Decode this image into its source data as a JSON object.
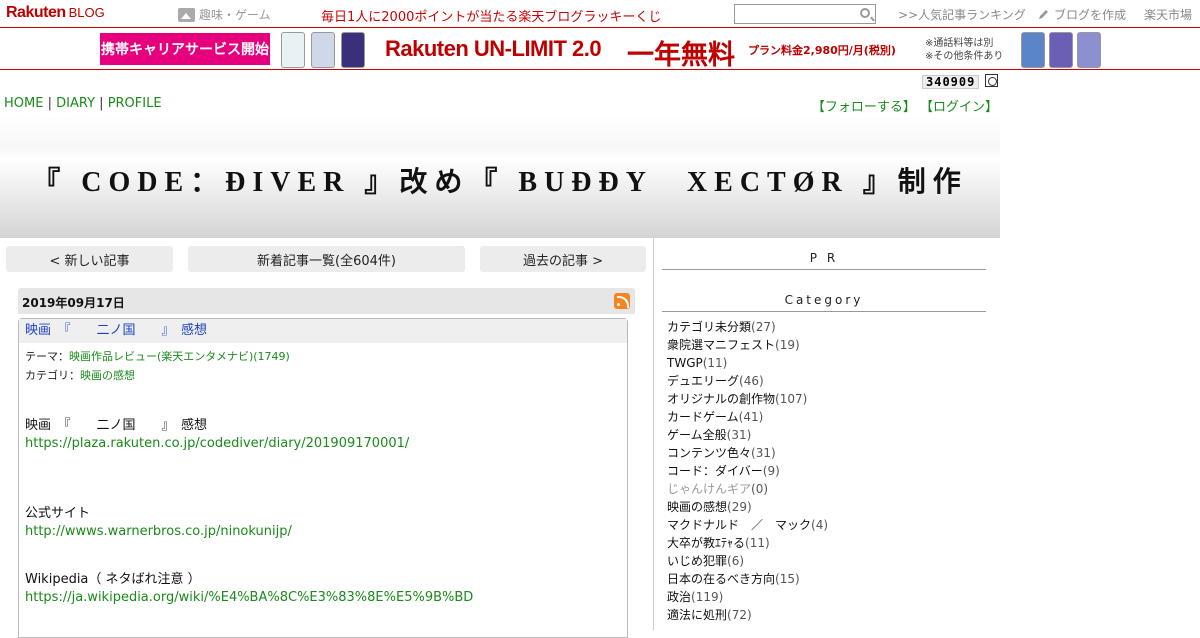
{
  "topbar": {
    "logo_brand": "Rakuten",
    "logo_blog": "BLOG",
    "hobby": "趣味・ゲーム",
    "lucky": "毎日1人に2000ポイントが当たる楽天ブログラッキーくじ",
    "ranking": ">>人気記事ランキング",
    "create_blog": "ブログを作成",
    "market": "楽天市場"
  },
  "ad": {
    "badge": "携帯キャリアサービス開始",
    "main": "Rakuten UN-LIMIT 2.0",
    "free": "一年無料",
    "price": "プラン料金2,980円/月(税別)",
    "note1": "※通話料等は別",
    "note2": "※その他条件あり"
  },
  "counter": "340909",
  "nav": {
    "home": "HOME",
    "diary": "DIARY",
    "profile": "PROFILE",
    "sep": "|"
  },
  "follow": {
    "follow": "【フォローする】",
    "login": "【ログイン】"
  },
  "header_title": "『 CODE：ÐIVER 』改め『 BUÐÐY　XECTØR 』制作",
  "pager": {
    "newer": "< 新しい記事",
    "list": "新着記事一覧(全604件)",
    "older": "過去の記事 >"
  },
  "entry": {
    "date": "2019年09月17日",
    "title": "映画　『　　二ノ国　　』　感想",
    "theme_label": "テーマ：",
    "theme_value": "映画作品レビュー(楽天エンタメナビ)(1749)",
    "category_label": "カテゴリ：",
    "category_value": "映画の感想",
    "line1": "映画　『　　二ノ国　　』　感想",
    "link1": "https://plaza.rakuten.co.jp/codediver/diary/201909170001/",
    "official_label": "公式サイト",
    "link2": "http://wwws.warnerbros.co.jp/ninokunijp/",
    "wiki_label": "Wikipedia（ ネタばれ注意 ）",
    "link3": "https://ja.wikipedia.org/wiki/%E4%BA%8C%E3%83%8E%E5%9B%BD"
  },
  "sidebar": {
    "pr": "P R",
    "category_head": "Category",
    "categories": [
      {
        "name": "カテゴリ未分類",
        "count": "(27)"
      },
      {
        "name": "衆院選マニフェスト",
        "count": "(19)"
      },
      {
        "name": "TWGP",
        "count": "(11)"
      },
      {
        "name": "デュエリーグ",
        "count": "(46)"
      },
      {
        "name": "オリジナルの創作物",
        "count": "(107)"
      },
      {
        "name": "カードゲーム",
        "count": "(41)"
      },
      {
        "name": "ゲーム全般",
        "count": "(31)"
      },
      {
        "name": "コンテンツ色々",
        "count": "(31)"
      },
      {
        "name": "コード：ダイバー",
        "count": "(9)"
      },
      {
        "name": "じゃんけんギア",
        "count": "(0)"
      },
      {
        "name": "映画の感想",
        "count": "(29)"
      },
      {
        "name": "マクドナルド　／　マック",
        "count": "(4)"
      },
      {
        "name": "大卒が教ｴﾃｬる",
        "count": "(11)"
      },
      {
        "name": "いじめ犯罪",
        "count": "(6)"
      },
      {
        "name": "日本の在るべき方向",
        "count": "(15)"
      },
      {
        "name": "政治",
        "count": "(119)"
      },
      {
        "name": "適法に処刑",
        "count": "(72)"
      }
    ]
  }
}
